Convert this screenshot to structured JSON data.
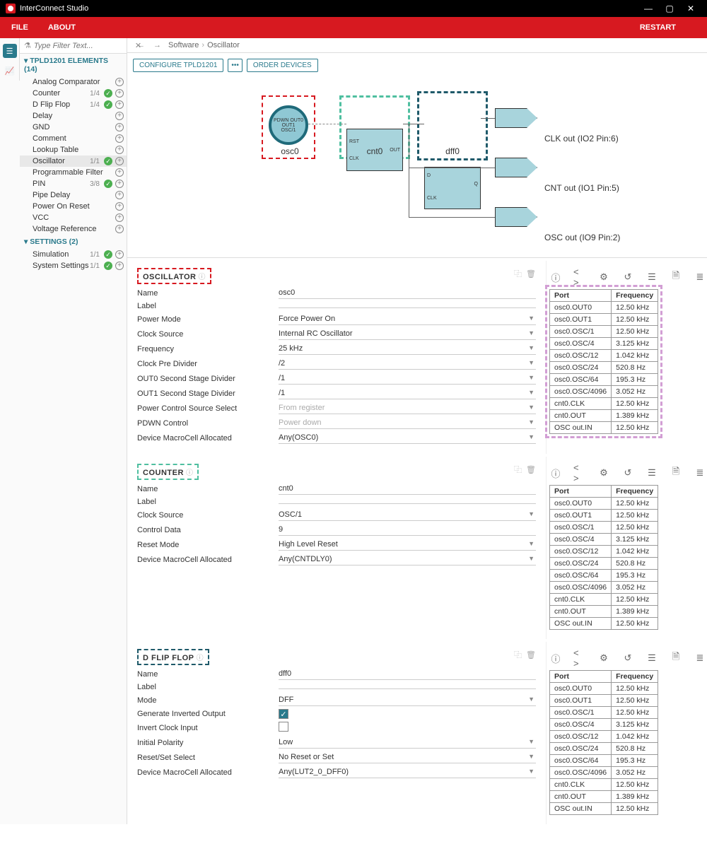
{
  "app": {
    "title": "InterConnect Studio"
  },
  "menubar": {
    "file": "FILE",
    "about": "ABOUT",
    "restart": "RESTART"
  },
  "filter": {
    "placeholder": "Type Filter Text..."
  },
  "tree": {
    "elements_header": "TPLD1201 ELEMENTS (14)",
    "settings_header": "SETTINGS (2)",
    "items": [
      {
        "label": "Analog Comparator",
        "count": "",
        "check": false
      },
      {
        "label": "Counter",
        "count": "1/4",
        "check": true
      },
      {
        "label": "D Flip Flop",
        "count": "1/4",
        "check": true
      },
      {
        "label": "Delay",
        "count": "",
        "check": false
      },
      {
        "label": "GND",
        "count": "",
        "check": false
      },
      {
        "label": "Comment",
        "count": "",
        "check": false
      },
      {
        "label": "Lookup Table",
        "count": "",
        "check": false
      },
      {
        "label": "Oscillator",
        "count": "1/1",
        "check": true,
        "selected": true
      },
      {
        "label": "Programmable Filter",
        "count": "",
        "check": false
      },
      {
        "label": "PIN",
        "count": "3/8",
        "check": true
      },
      {
        "label": "Pipe Delay",
        "count": "",
        "check": false
      },
      {
        "label": "Power On Reset",
        "count": "",
        "check": false
      },
      {
        "label": "VCC",
        "count": "",
        "check": false
      },
      {
        "label": "Voltage Reference",
        "count": "",
        "check": false
      }
    ],
    "settings": [
      {
        "label": "Simulation",
        "count": "1/1",
        "check": true
      },
      {
        "label": "System Settings",
        "count": "1/1",
        "check": true
      }
    ]
  },
  "breadcrumb": {
    "parts": [
      "Software",
      "Oscillator"
    ]
  },
  "cfgbtns": {
    "configure": "CONFIGURE TPLD1201",
    "more": "•••",
    "order": "ORDER DEVICES"
  },
  "diagram": {
    "osc": "osc0",
    "cnt": "cnt0",
    "dff": "dff0",
    "pins": [
      "CLK out (IO2 Pin:6)",
      "CNT out (IO1 Pin:5)",
      "OSC out (IO9 Pin:2)"
    ]
  },
  "panels": [
    {
      "title": "OSCILLATOR",
      "borderColor": "#d71920",
      "props": [
        {
          "label": "Name",
          "value": "osc0",
          "type": "text"
        },
        {
          "label": "Label",
          "value": "",
          "type": "text"
        },
        {
          "label": "Power Mode",
          "value": "Force Power On",
          "type": "select"
        },
        {
          "label": "Clock Source",
          "value": "Internal RC Oscillator",
          "type": "select"
        },
        {
          "label": "Frequency",
          "value": "25 kHz",
          "type": "select"
        },
        {
          "label": "Clock Pre Divider",
          "value": "/2",
          "type": "select"
        },
        {
          "label": "OUT0 Second Stage Divider",
          "value": "/1",
          "type": "select"
        },
        {
          "label": "OUT1 Second Stage Divider",
          "value": "/1",
          "type": "select"
        },
        {
          "label": "Power Control Source Select",
          "value": "From register",
          "type": "select",
          "muted": true
        },
        {
          "label": "PDWN Control",
          "value": "Power down",
          "type": "select",
          "muted": true
        },
        {
          "label": "Device MacroCell Allocated",
          "value": "Any(OSC0)",
          "type": "select"
        }
      ],
      "tableHL": true
    },
    {
      "title": "COUNTER",
      "borderColor": "#4fbfa0",
      "props": [
        {
          "label": "Name",
          "value": "cnt0",
          "type": "text"
        },
        {
          "label": "Label",
          "value": "",
          "type": "text"
        },
        {
          "label": "Clock Source",
          "value": "OSC/1",
          "type": "select"
        },
        {
          "label": "Control Data",
          "value": "9",
          "type": "text"
        },
        {
          "label": "Reset Mode",
          "value": "High Level Reset",
          "type": "select"
        },
        {
          "label": "Device MacroCell Allocated",
          "value": "Any(CNTDLY0)",
          "type": "select"
        }
      ]
    },
    {
      "title": "D FLIP FLOP",
      "borderColor": "#1f5a6a",
      "props": [
        {
          "label": "Name",
          "value": "dff0",
          "type": "text"
        },
        {
          "label": "Label",
          "value": "",
          "type": "text"
        },
        {
          "label": "Mode",
          "value": "DFF",
          "type": "select"
        },
        {
          "label": "Generate Inverted Output",
          "value": "checked",
          "type": "checkbox"
        },
        {
          "label": "Invert Clock Input",
          "value": "",
          "type": "checkbox"
        },
        {
          "label": "Initial Polarity",
          "value": "Low",
          "type": "select"
        },
        {
          "label": "Reset/Set Select",
          "value": "No Reset or Set",
          "type": "select"
        },
        {
          "label": "Device MacroCell Allocated",
          "value": "Any(LUT2_0_DFF0)",
          "type": "select"
        }
      ]
    }
  ],
  "freqTable": {
    "headers": [
      "Port",
      "Frequency"
    ],
    "rows": [
      [
        "osc0.OUT0",
        "12.50 kHz"
      ],
      [
        "osc0.OUT1",
        "12.50 kHz"
      ],
      [
        "osc0.OSC/1",
        "12.50 kHz"
      ],
      [
        "osc0.OSC/4",
        "3.125 kHz"
      ],
      [
        "osc0.OSC/12",
        "1.042 kHz"
      ],
      [
        "osc0.OSC/24",
        "520.8 Hz"
      ],
      [
        "osc0.OSC/64",
        "195.3 Hz"
      ],
      [
        "osc0.OSC/4096",
        "3.052 Hz"
      ],
      [
        "cnt0.CLK",
        "12.50 kHz"
      ],
      [
        "cnt0.OUT",
        "1.389 kHz"
      ],
      [
        "OSC out.IN",
        "12.50 kHz"
      ]
    ]
  },
  "iconTabs": [
    "ⓘ",
    "< >",
    "⚙",
    "↺",
    "☰",
    "🗎",
    "≣",
    "⎍",
    "⚡",
    "⇲",
    "▭"
  ]
}
